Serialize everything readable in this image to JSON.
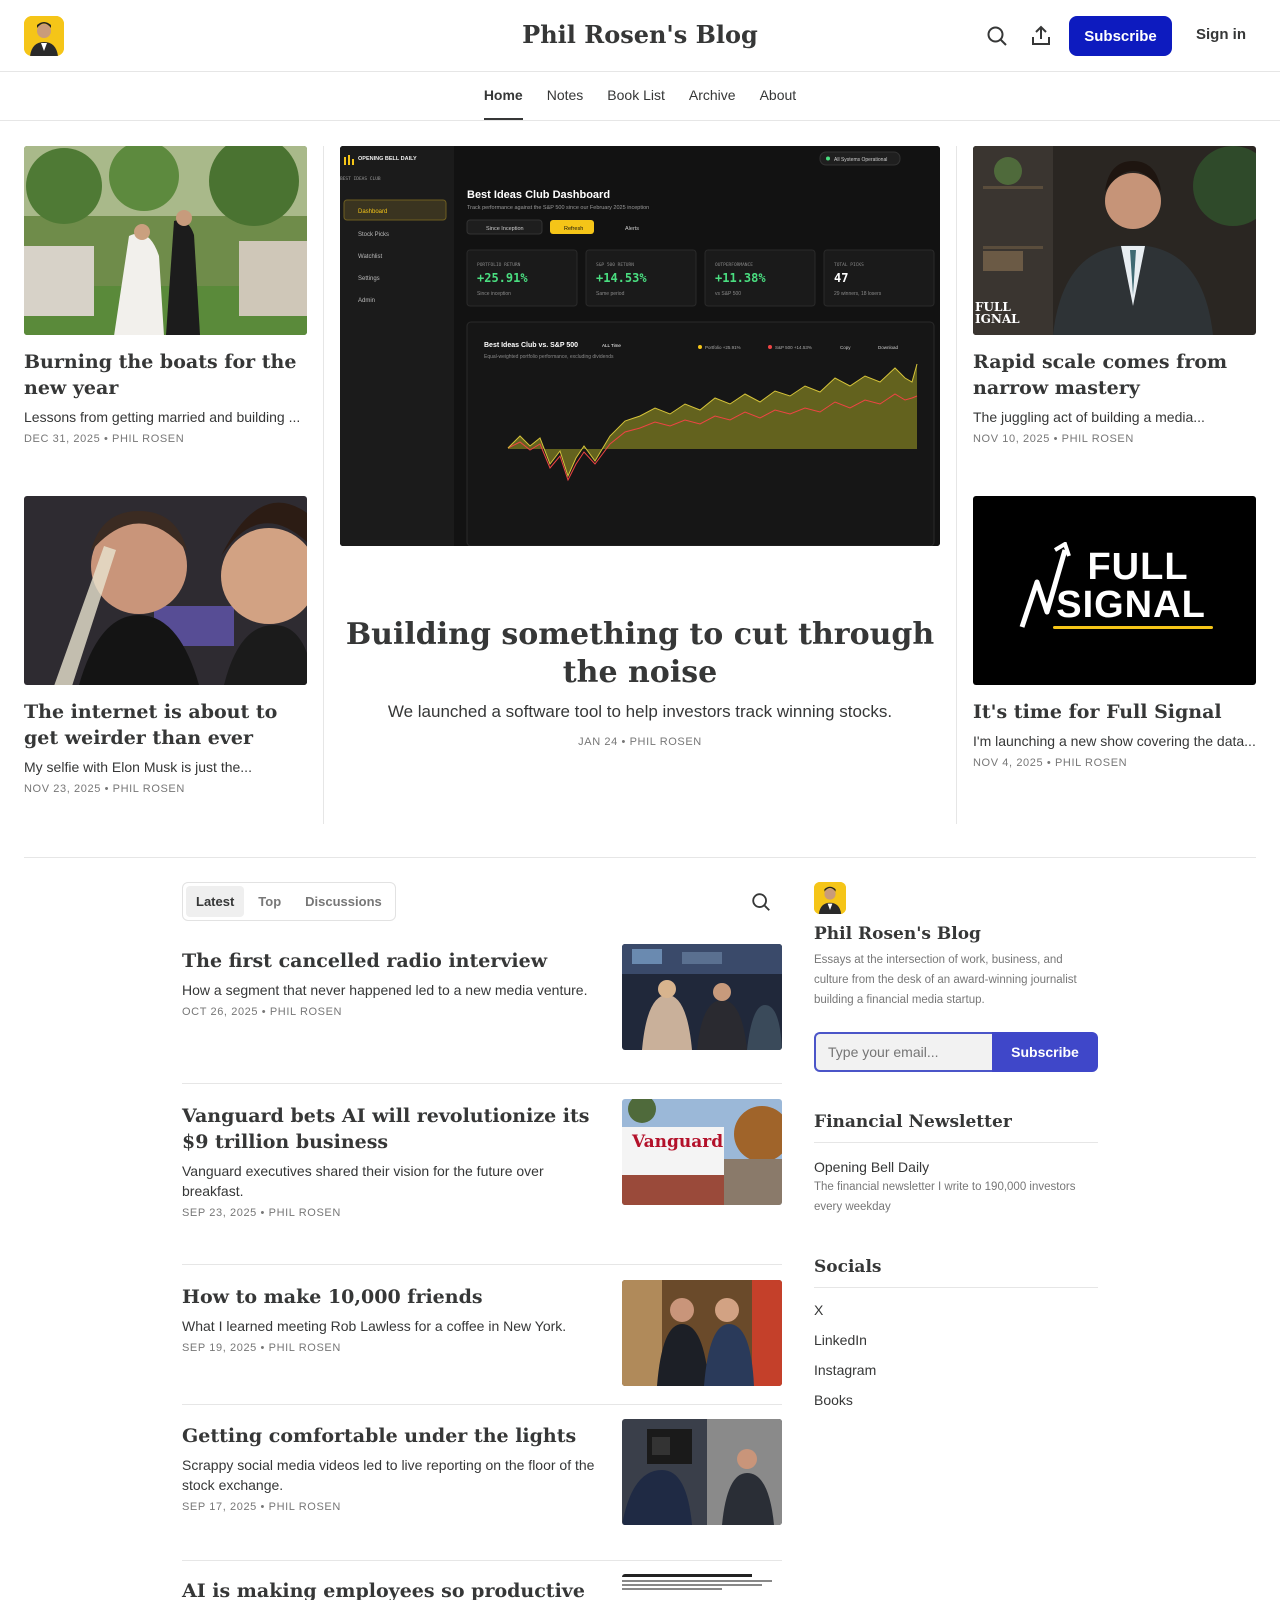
{
  "header": {
    "site_title": "Phil Rosen's Blog",
    "subscribe_label": "Subscribe",
    "signin_label": "Sign in"
  },
  "nav": {
    "items": [
      {
        "label": "Home",
        "active": true
      },
      {
        "label": "Notes"
      },
      {
        "label": "Book List"
      },
      {
        "label": "Archive"
      },
      {
        "label": "About"
      }
    ]
  },
  "featured": {
    "left": [
      {
        "title": "Burning the boats for the new year",
        "subtitle": "Lessons from getting married and building ...",
        "meta": "DEC 31, 2025 • PHIL ROSEN"
      },
      {
        "title": "The internet is about to get weirder than ever",
        "subtitle": "My selfie with Elon Musk is just the...",
        "meta": "NOV 23, 2025 • PHIL ROSEN"
      }
    ],
    "right": [
      {
        "title": "Rapid scale comes from narrow mastery",
        "subtitle": "The juggling act of building a media...",
        "meta": "NOV 10, 2025 • PHIL ROSEN",
        "img_text": "FULL IGNAL"
      },
      {
        "title": "It's time for Full Signal",
        "subtitle": "I'm launching a new show covering the data...",
        "meta": "NOV 4, 2025 • PHIL ROSEN",
        "img_text_1": "FULL",
        "img_text_2": "SIGNAL"
      }
    ],
    "hero": {
      "title": "Building something to cut through the noise",
      "subtitle": "We launched a software tool to help investors track winning stocks.",
      "meta": "JAN 24 • PHIL ROSEN",
      "dashboard": {
        "brand": "OPENING BELL DAILY",
        "brand_sub": "BEST IDEAS CLUB",
        "status": "All Systems Operational",
        "menu": [
          "Dashboard",
          "Stock Picks",
          "Watchlist",
          "Settings",
          "Admin"
        ],
        "title": "Best Ideas Club Dashboard",
        "subtitle": "Track performance against the S&P 500 since our February 2025 inception",
        "controls": [
          "Since Inception",
          "Refresh",
          "Alerts"
        ],
        "kpis": [
          {
            "label": "PORTFOLIO RETURN",
            "value": "+25.91%",
            "note": "Since inception"
          },
          {
            "label": "S&P 500 RETURN",
            "value": "+14.53%",
            "note": "Same period"
          },
          {
            "label": "OUTPERFORMANCE",
            "value": "+11.38%",
            "note": "vs S&P 500"
          },
          {
            "label": "TOTAL PICKS",
            "value": "47",
            "note": "29 winners, 18 losers"
          }
        ],
        "chart_title": "Best Ideas Club vs. S&P 500",
        "chart_badge": "ALL Time",
        "chart_sub": "Equal-weighted portfolio performance, excluding dividends",
        "legend": [
          "Portfolio +25.91%",
          "S&P 500 +14.53%"
        ],
        "actions": [
          "Copy",
          "Download"
        ]
      }
    }
  },
  "tabs": [
    {
      "label": "Latest",
      "active": true
    },
    {
      "label": "Top"
    },
    {
      "label": "Discussions"
    }
  ],
  "posts": [
    {
      "title": "The first cancelled radio interview",
      "subtitle": "How a segment that never happened led to a new media venture.",
      "meta": "OCT 26, 2025 • PHIL ROSEN"
    },
    {
      "title": "Vanguard bets AI will revolutionize its $9 trillion business",
      "subtitle": "Vanguard executives shared their vision for the future over breakfast.",
      "meta": "SEP 23, 2025 • PHIL ROSEN",
      "img_text": "Vanguard"
    },
    {
      "title": "How to make 10,000 friends",
      "subtitle": "What I learned meeting Rob Lawless for a coffee in New York.",
      "meta": "SEP 19, 2025 • PHIL ROSEN"
    },
    {
      "title": "Getting comfortable under the lights",
      "subtitle": "Scrappy social media videos led to live reporting on the floor of the stock exchange.",
      "meta": "SEP 17, 2025 • PHIL ROSEN"
    },
    {
      "title": "AI is making employees so productive that",
      "subtitle": "",
      "meta": ""
    }
  ],
  "sidebar": {
    "name": "Phil Rosen's Blog",
    "description": "Essays at the intersection of work, business, and culture from the desk of an award-winning journalist building a financial media startup.",
    "email_placeholder": "Type your email...",
    "subscribe_label": "Subscribe",
    "newsletter_heading": "Financial Newsletter",
    "newsletter_name": "Opening Bell Daily",
    "newsletter_desc": "The financial newsletter I write to 190,000 investors every weekday",
    "socials_heading": "Socials",
    "socials": [
      "X",
      "LinkedIn",
      "Instagram",
      "Books"
    ]
  },
  "colors": {
    "brand": "#0d1bbf",
    "subscribe_side": "#3f47c9",
    "logo_bg": "#f5c518"
  }
}
